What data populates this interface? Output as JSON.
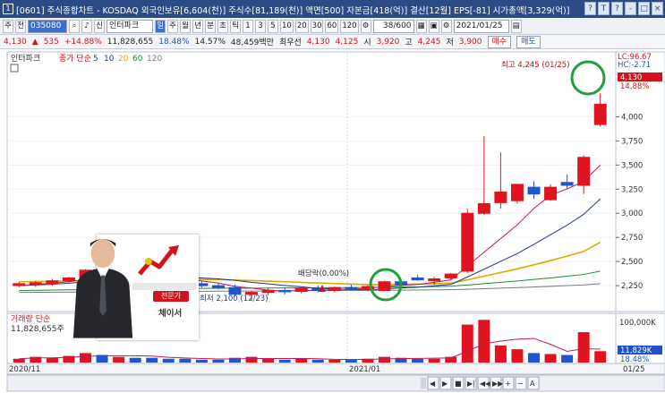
{
  "titlebar": {
    "icon": "1",
    "text": "[0601] 주식종합차트 - KOSDAQ 외국인보유[6,604(천)] 주식수[81,189(천)] 액면[500] 자본금[418(억)] 결산[12월] EPS[-81] 시가총액[3,329(억)]",
    "buttons": [
      "?",
      "T",
      "?",
      "-",
      "□",
      "×"
    ]
  },
  "toolbar": {
    "period_label": "주",
    "view_label": "전",
    "code": "035080",
    "stock_name": "인터파크",
    "period_buttons": [
      "일",
      "주",
      "월",
      "년",
      "분",
      "초",
      "틱"
    ],
    "interval_buttons": [
      "1",
      "3",
      "5",
      "10",
      "20",
      "30",
      "60",
      "120"
    ],
    "count": "38/600",
    "date": "2021/01/25"
  },
  "quote": {
    "price": "4,130",
    "change": "535",
    "change_pct": "+14.88%",
    "volume": "11,828,655",
    "volume_ratio": "18.48%",
    "turnover": "14.57%",
    "amount": "48,459백만",
    "best_ask_label": "최우선",
    "best_ask": "4,130",
    "best_bid": "4,125",
    "open_label": "시",
    "open": "3,920",
    "high_label": "고",
    "high": "4,245",
    "low_label": "저",
    "low": "3,900",
    "buy_button": "매수",
    "sell_button": "매도"
  },
  "panel": {
    "legend_name": "인터파크",
    "legend_ma": "종가 단순",
    "ma_periods": [
      "5",
      "10",
      "20",
      "60",
      "120"
    ],
    "ma_colors": [
      "#d3131c",
      "#1f3a8a",
      "#e0a800",
      "#1f8a3a",
      "#7a7a7a"
    ],
    "lc_label": "LC:96.67",
    "hc_label": "HC:-2.71",
    "high_note": "최고 4,245 (01/25)",
    "low_note": "최저 2,100 (12/23)",
    "dividend_note": "배당락(0.00%)",
    "price_tag": "4,130",
    "pct_tag": "14.88%",
    "volume_title": "거래량 단순",
    "volume_value": "11,828,655주",
    "volume_axis_top": "100,000K",
    "volume_tag": "11,829K",
    "volume_pct_tag": "18.48%",
    "x_labels": [
      "2020/11",
      "2021/01",
      "01/25"
    ],
    "brand_tag": "전문가",
    "brand_name": "체이서"
  },
  "chart_data": {
    "type": "candlestick",
    "y_ticks": [
      "4,000",
      "3,750",
      "3,500",
      "3,250",
      "3,000",
      "2,750",
      "2,500",
      "2,250"
    ],
    "ylim": [
      2000,
      4450
    ],
    "candles": [
      {
        "o": 2250,
        "h": 2290,
        "l": 2230,
        "c": 2270
      },
      {
        "o": 2260,
        "h": 2300,
        "l": 2235,
        "c": 2280
      },
      {
        "o": 2275,
        "h": 2320,
        "l": 2250,
        "c": 2300
      },
      {
        "o": 2300,
        "h": 2340,
        "l": 2275,
        "c": 2330
      },
      {
        "o": 2330,
        "h": 2420,
        "l": 2320,
        "c": 2410
      },
      {
        "o": 2410,
        "h": 2440,
        "l": 2340,
        "c": 2360
      },
      {
        "o": 2360,
        "h": 2400,
        "l": 2320,
        "c": 2390
      },
      {
        "o": 2390,
        "h": 2410,
        "l": 2320,
        "c": 2340
      },
      {
        "o": 2340,
        "h": 2380,
        "l": 2300,
        "c": 2330
      },
      {
        "o": 2330,
        "h": 2360,
        "l": 2290,
        "c": 2300
      },
      {
        "o": 2300,
        "h": 2330,
        "l": 2250,
        "c": 2270
      },
      {
        "o": 2270,
        "h": 2300,
        "l": 2230,
        "c": 2250
      },
      {
        "o": 2250,
        "h": 2280,
        "l": 2210,
        "c": 2230
      },
      {
        "o": 2230,
        "h": 2260,
        "l": 2140,
        "c": 2160
      },
      {
        "o": 2160,
        "h": 2200,
        "l": 2100,
        "c": 2180
      },
      {
        "o": 2180,
        "h": 2220,
        "l": 2150,
        "c": 2200
      },
      {
        "o": 2200,
        "h": 2230,
        "l": 2160,
        "c": 2190
      },
      {
        "o": 2190,
        "h": 2240,
        "l": 2170,
        "c": 2220
      },
      {
        "o": 2220,
        "h": 2250,
        "l": 2180,
        "c": 2200
      },
      {
        "o": 2200,
        "h": 2240,
        "l": 2180,
        "c": 2230
      },
      {
        "o": 2230,
        "h": 2260,
        "l": 2200,
        "c": 2210
      },
      {
        "o": 2210,
        "h": 2250,
        "l": 2190,
        "c": 2240
      },
      {
        "o": 2200,
        "h": 2300,
        "l": 2190,
        "c": 2290
      },
      {
        "o": 2290,
        "h": 2320,
        "l": 2240,
        "c": 2260
      },
      {
        "o": 2330,
        "h": 2360,
        "l": 2300,
        "c": 2310
      },
      {
        "o": 2300,
        "h": 2340,
        "l": 2260,
        "c": 2320
      },
      {
        "o": 2330,
        "h": 2380,
        "l": 2310,
        "c": 2370
      },
      {
        "o": 2400,
        "h": 3050,
        "l": 2380,
        "c": 3000
      },
      {
        "o": 3000,
        "h": 3800,
        "l": 2980,
        "c": 3100
      },
      {
        "o": 3110,
        "h": 3630,
        "l": 3050,
        "c": 3220
      },
      {
        "o": 3130,
        "h": 3300,
        "l": 3100,
        "c": 3300
      },
      {
        "o": 3270,
        "h": 3330,
        "l": 3150,
        "c": 3200
      },
      {
        "o": 3140,
        "h": 3300,
        "l": 3130,
        "c": 3270
      },
      {
        "o": 3320,
        "h": 3400,
        "l": 3250,
        "c": 3290
      },
      {
        "o": 3290,
        "h": 3600,
        "l": 3200,
        "c": 3580
      },
      {
        "o": 3920,
        "h": 4245,
        "l": 3900,
        "c": 4130
      }
    ],
    "volumes": [
      4,
      6,
      5,
      7,
      10,
      8,
      6,
      5,
      5,
      4,
      4,
      3,
      3,
      5,
      6,
      4,
      3,
      4,
      3,
      3,
      3,
      4,
      6,
      5,
      4,
      4,
      6,
      40,
      45,
      18,
      14,
      10,
      9,
      8,
      32,
      12
    ],
    "ma5": [
      2250,
      2262,
      2275,
      2290,
      2318,
      2336,
      2358,
      2370,
      2366,
      2344,
      2328,
      2298,
      2276,
      2242,
      2224,
      2204,
      2192,
      2198,
      2202,
      2208,
      2214,
      2220,
      2242,
      2252,
      2262,
      2284,
      2310,
      2452,
      2596,
      2738,
      2880,
      3050,
      3188,
      3252,
      3330,
      3500
    ],
    "ma10": [
      2250,
      2256,
      2265,
      2275,
      2290,
      2304,
      2318,
      2330,
      2337,
      2338,
      2338,
      2330,
      2320,
      2305,
      2284,
      2268,
      2252,
      2238,
      2222,
      2216,
      2210,
      2206,
      2216,
      2226,
      2233,
      2248,
      2262,
      2340,
      2420,
      2502,
      2582,
      2678,
      2778,
      2876,
      2990,
      3150
    ],
    "ma20": [
      2290,
      2292,
      2295,
      2298,
      2302,
      2306,
      2310,
      2313,
      2315,
      2316,
      2316,
      2314,
      2312,
      2308,
      2302,
      2296,
      2290,
      2284,
      2278,
      2272,
      2266,
      2260,
      2262,
      2264,
      2266,
      2270,
      2276,
      2310,
      2348,
      2386,
      2424,
      2466,
      2510,
      2556,
      2604,
      2700
    ],
    "ma60": [
      2200,
      2202,
      2204,
      2206,
      2208,
      2210,
      2212,
      2214,
      2216,
      2218,
      2220,
      2222,
      2223,
      2224,
      2224,
      2225,
      2226,
      2227,
      2228,
      2229,
      2230,
      2231,
      2233,
      2235,
      2237,
      2240,
      2244,
      2256,
      2270,
      2284,
      2298,
      2314,
      2330,
      2348,
      2366,
      2400
    ],
    "ma120": [
      2180,
      2181,
      2182,
      2183,
      2184,
      2185,
      2186,
      2187,
      2188,
      2189,
      2190,
      2191,
      2192,
      2193,
      2194,
      2195,
      2196,
      2197,
      2198,
      2199,
      2200,
      2201,
      2202,
      2203,
      2204,
      2206,
      2208,
      2212,
      2218,
      2224,
      2230,
      2236,
      2242,
      2250,
      2258,
      2270
    ]
  }
}
